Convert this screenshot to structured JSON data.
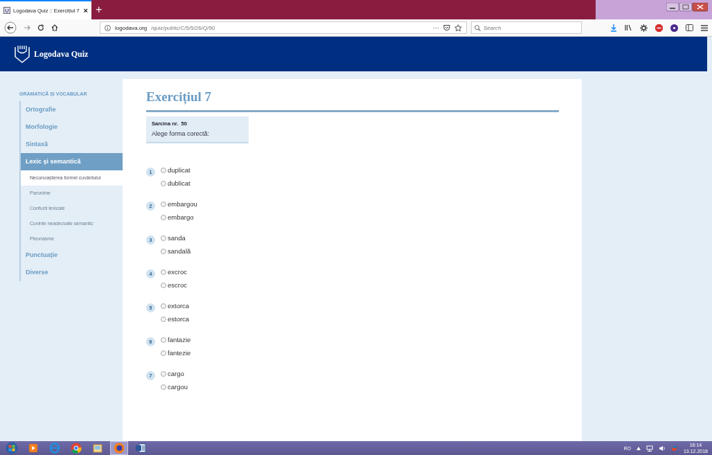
{
  "browser": {
    "tab": {
      "title": "Logodava Quiz :: Exercițiul 7",
      "close": "×",
      "selected": true
    },
    "new_tab": "+",
    "address": {
      "domain": "logodava.org",
      "path": "/quiz/public/C/5/5/26/Q/50",
      "more": "···"
    },
    "search": {
      "placeholder": "Search"
    }
  },
  "site": {
    "logo": "Logodava Quiz"
  },
  "sidebar": {
    "heading": "GRAMATICĂ ȘI VOCABULAR",
    "items": [
      {
        "label": "Ortografie",
        "selected": false
      },
      {
        "label": "Morfologie",
        "selected": false
      },
      {
        "label": "Sintaxă",
        "selected": false
      },
      {
        "label": "Lexic și semantică",
        "selected": true,
        "children": [
          {
            "label": "Necunoașterea formei cuvântului",
            "selected": true
          },
          {
            "label": "Paronime",
            "selected": false
          },
          {
            "label": "Confuzii lexicale",
            "selected": false
          },
          {
            "label": "Cuvinte neadecvate semantic",
            "selected": false
          },
          {
            "label": "Pleonasme",
            "selected": false
          }
        ]
      },
      {
        "label": "Punctuație",
        "selected": false
      },
      {
        "label": "Diverse",
        "selected": false
      }
    ]
  },
  "exercise": {
    "title": "Exercițiul 7",
    "task": {
      "label": "Sarcina nr.  50",
      "prompt": "Alege forma corectă:"
    },
    "questions": [
      {
        "number": "1",
        "options": [
          {
            "label": "duplicat",
            "checked": false
          },
          {
            "label": "dublicat",
            "checked": false
          }
        ]
      },
      {
        "number": "2",
        "options": [
          {
            "label": "embargou",
            "checked": false
          },
          {
            "label": "embargo",
            "checked": false
          }
        ]
      },
      {
        "number": "3",
        "options": [
          {
            "label": "sanda",
            "checked": false
          },
          {
            "label": "sandală",
            "checked": false
          }
        ]
      },
      {
        "number": "4",
        "options": [
          {
            "label": "excroc",
            "checked": false
          },
          {
            "label": "escroc",
            "checked": false
          }
        ]
      },
      {
        "number": "5",
        "options": [
          {
            "label": "extorca",
            "checked": false
          },
          {
            "label": "estorca",
            "checked": false
          }
        ]
      },
      {
        "number": "6",
        "options": [
          {
            "label": "fantazie",
            "checked": false
          },
          {
            "label": "fantezie",
            "checked": false
          }
        ]
      },
      {
        "number": "7",
        "options": [
          {
            "label": "cargo",
            "checked": false
          },
          {
            "label": "cargou",
            "checked": false
          }
        ]
      }
    ]
  },
  "taskbar": {
    "apps": [
      {
        "kind": "start",
        "selected": false
      },
      {
        "kind": "media",
        "selected": false
      },
      {
        "kind": "ie",
        "selected": false
      },
      {
        "kind": "chrome",
        "selected": false
      },
      {
        "kind": "folder",
        "selected": false
      },
      {
        "kind": "firefox",
        "selected": true
      },
      {
        "kind": "word",
        "selected": false
      }
    ],
    "tray": {
      "language": "RO",
      "time": "16:14",
      "date": "13.12.2018"
    }
  }
}
